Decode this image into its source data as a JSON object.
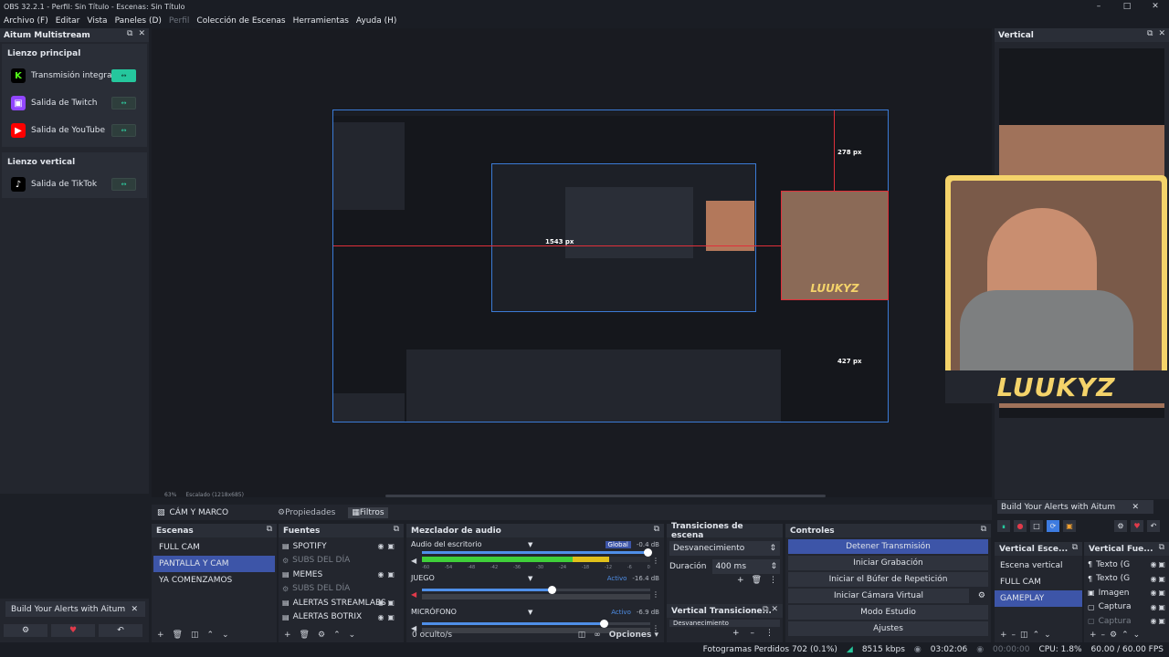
{
  "window": {
    "title": "OBS 32.2.1 - Perfil: Sin Título - Escenas: Sin Título"
  },
  "menu": [
    {
      "label": "Archivo (F)",
      "enabled": true
    },
    {
      "label": "Editar",
      "enabled": true
    },
    {
      "label": "Vista",
      "enabled": true
    },
    {
      "label": "Paneles (D)",
      "enabled": true
    },
    {
      "label": "Perfil",
      "enabled": false
    },
    {
      "label": "Colección de Escenas",
      "enabled": true
    },
    {
      "label": "Herramientas",
      "enabled": true
    },
    {
      "label": "Ayuda (H)",
      "enabled": true
    }
  ],
  "aitum": {
    "title": "Aitum Multistream",
    "main_canvas": "Lienzo principal",
    "vertical_canvas": "Lienzo vertical",
    "outputs": [
      {
        "label": "Transmisión integrada",
        "icon": "kick-icon",
        "color": "#53fc18",
        "active": true
      },
      {
        "label": "Salida de Twitch",
        "icon": "twitch-icon",
        "color": "#9146ff",
        "active": false
      },
      {
        "label": "Salida de YouTube",
        "icon": "youtube-icon",
        "color": "#ff0000",
        "active": false
      }
    ],
    "vertical_outputs": [
      {
        "label": "Salida de TikTok",
        "icon": "tiktok-icon",
        "color": "#000000",
        "active": false
      }
    ]
  },
  "left_bottom": {
    "alert_label": "Build Your Alerts with Aitum"
  },
  "preview": {
    "zoom": "63%",
    "scaling": "Escalado (1218x685)",
    "guide_width_label": "1543 px",
    "guide_top_label": "278 px",
    "guide_left_label": "427 px",
    "watermark": "LUUKYZ"
  },
  "vertical": {
    "title": "Vertical",
    "overlay_name": "LUUKYZ",
    "alert_label": "Build Your Alerts with Aitum",
    "scenes_title": "Vertical Esce...",
    "scenes": [
      {
        "label": "Escena vertical",
        "selected": false
      },
      {
        "label": "FULL CAM",
        "selected": false
      },
      {
        "label": "GAMEPLAY",
        "selected": true
      }
    ],
    "sources_title": "Vertical Fue...",
    "sources": [
      {
        "label": "Texto (G",
        "icon": "text-icon"
      },
      {
        "label": "Texto (G",
        "icon": "text-icon"
      },
      {
        "label": "Imagen",
        "icon": "image-icon"
      },
      {
        "label": "Captura",
        "icon": "capture-icon"
      },
      {
        "label": "Captura",
        "icon": "capture-icon"
      }
    ]
  },
  "context_bar": {
    "source": "CÁM Y MARCO",
    "properties": "Propiedades",
    "filters": "Filtros"
  },
  "scenes": {
    "title": "Escenas",
    "items": [
      {
        "label": "FULL CAM",
        "selected": false
      },
      {
        "label": "PANTALLA Y CAM",
        "selected": true
      },
      {
        "label": "YA COMENZAMOS",
        "selected": false
      }
    ]
  },
  "sources": {
    "title": "Fuentes",
    "items": [
      {
        "label": "SPOTIFY",
        "dim": false
      },
      {
        "label": "SUBS DEL DÍA",
        "dim": true
      },
      {
        "label": "MEMES",
        "dim": false
      },
      {
        "label": "SUBS DEL DÍA",
        "dim": true
      },
      {
        "label": "ALERTAS STREAMLABS",
        "dim": false
      },
      {
        "label": "ALERTAS BOTRIX",
        "dim": false
      }
    ]
  },
  "mixer": {
    "title": "Mezclador de audio",
    "channels": [
      {
        "name": "Audio del escritorio",
        "badge": "Global",
        "db": "-0.4 dB",
        "level": 0.82,
        "volume": 0.99
      },
      {
        "name": "JUEGO",
        "badge": "Activo",
        "db": "-16.4 dB",
        "level": 0.0,
        "volume": 0.57
      },
      {
        "name": "MICRÓFONO",
        "badge": "Activo",
        "db": "-6.9 dB",
        "level": 0.0,
        "volume": 0.8
      }
    ],
    "scale": [
      "-60",
      "-54",
      "-48",
      "-42",
      "-36",
      "-30",
      "-24",
      "-18",
      "-12",
      "-6",
      "0"
    ],
    "hidden": "0 oculto/s",
    "options": "Opciones"
  },
  "transitions": {
    "title": "Transiciones de escena",
    "selected": "Desvanecimiento",
    "duration_label": "Duración",
    "duration_value": "400 ms",
    "vertical_title": "Vertical Transicione...",
    "vertical_selected": "Desvanecimiento"
  },
  "controls": {
    "title": "Controles",
    "buttons": [
      {
        "label": "Detener Transmisión",
        "active": true
      },
      {
        "label": "Iniciar Grabación",
        "active": false
      },
      {
        "label": "Iniciar el Búfer de Repetición",
        "active": false
      },
      {
        "label": "Iniciar Cámara Virtual",
        "active": false
      },
      {
        "label": "Modo Estudio",
        "active": false
      },
      {
        "label": "Ajustes",
        "active": false
      }
    ]
  },
  "status": {
    "dropped": "Fotogramas Perdidos 702 (0.1%)",
    "bitrate": "8515 kbps",
    "stream_time": "03:02:06",
    "rec_time": "00:00:00",
    "cpu": "CPU: 1.8%",
    "fps": "60.00 / 60.00 FPS"
  }
}
